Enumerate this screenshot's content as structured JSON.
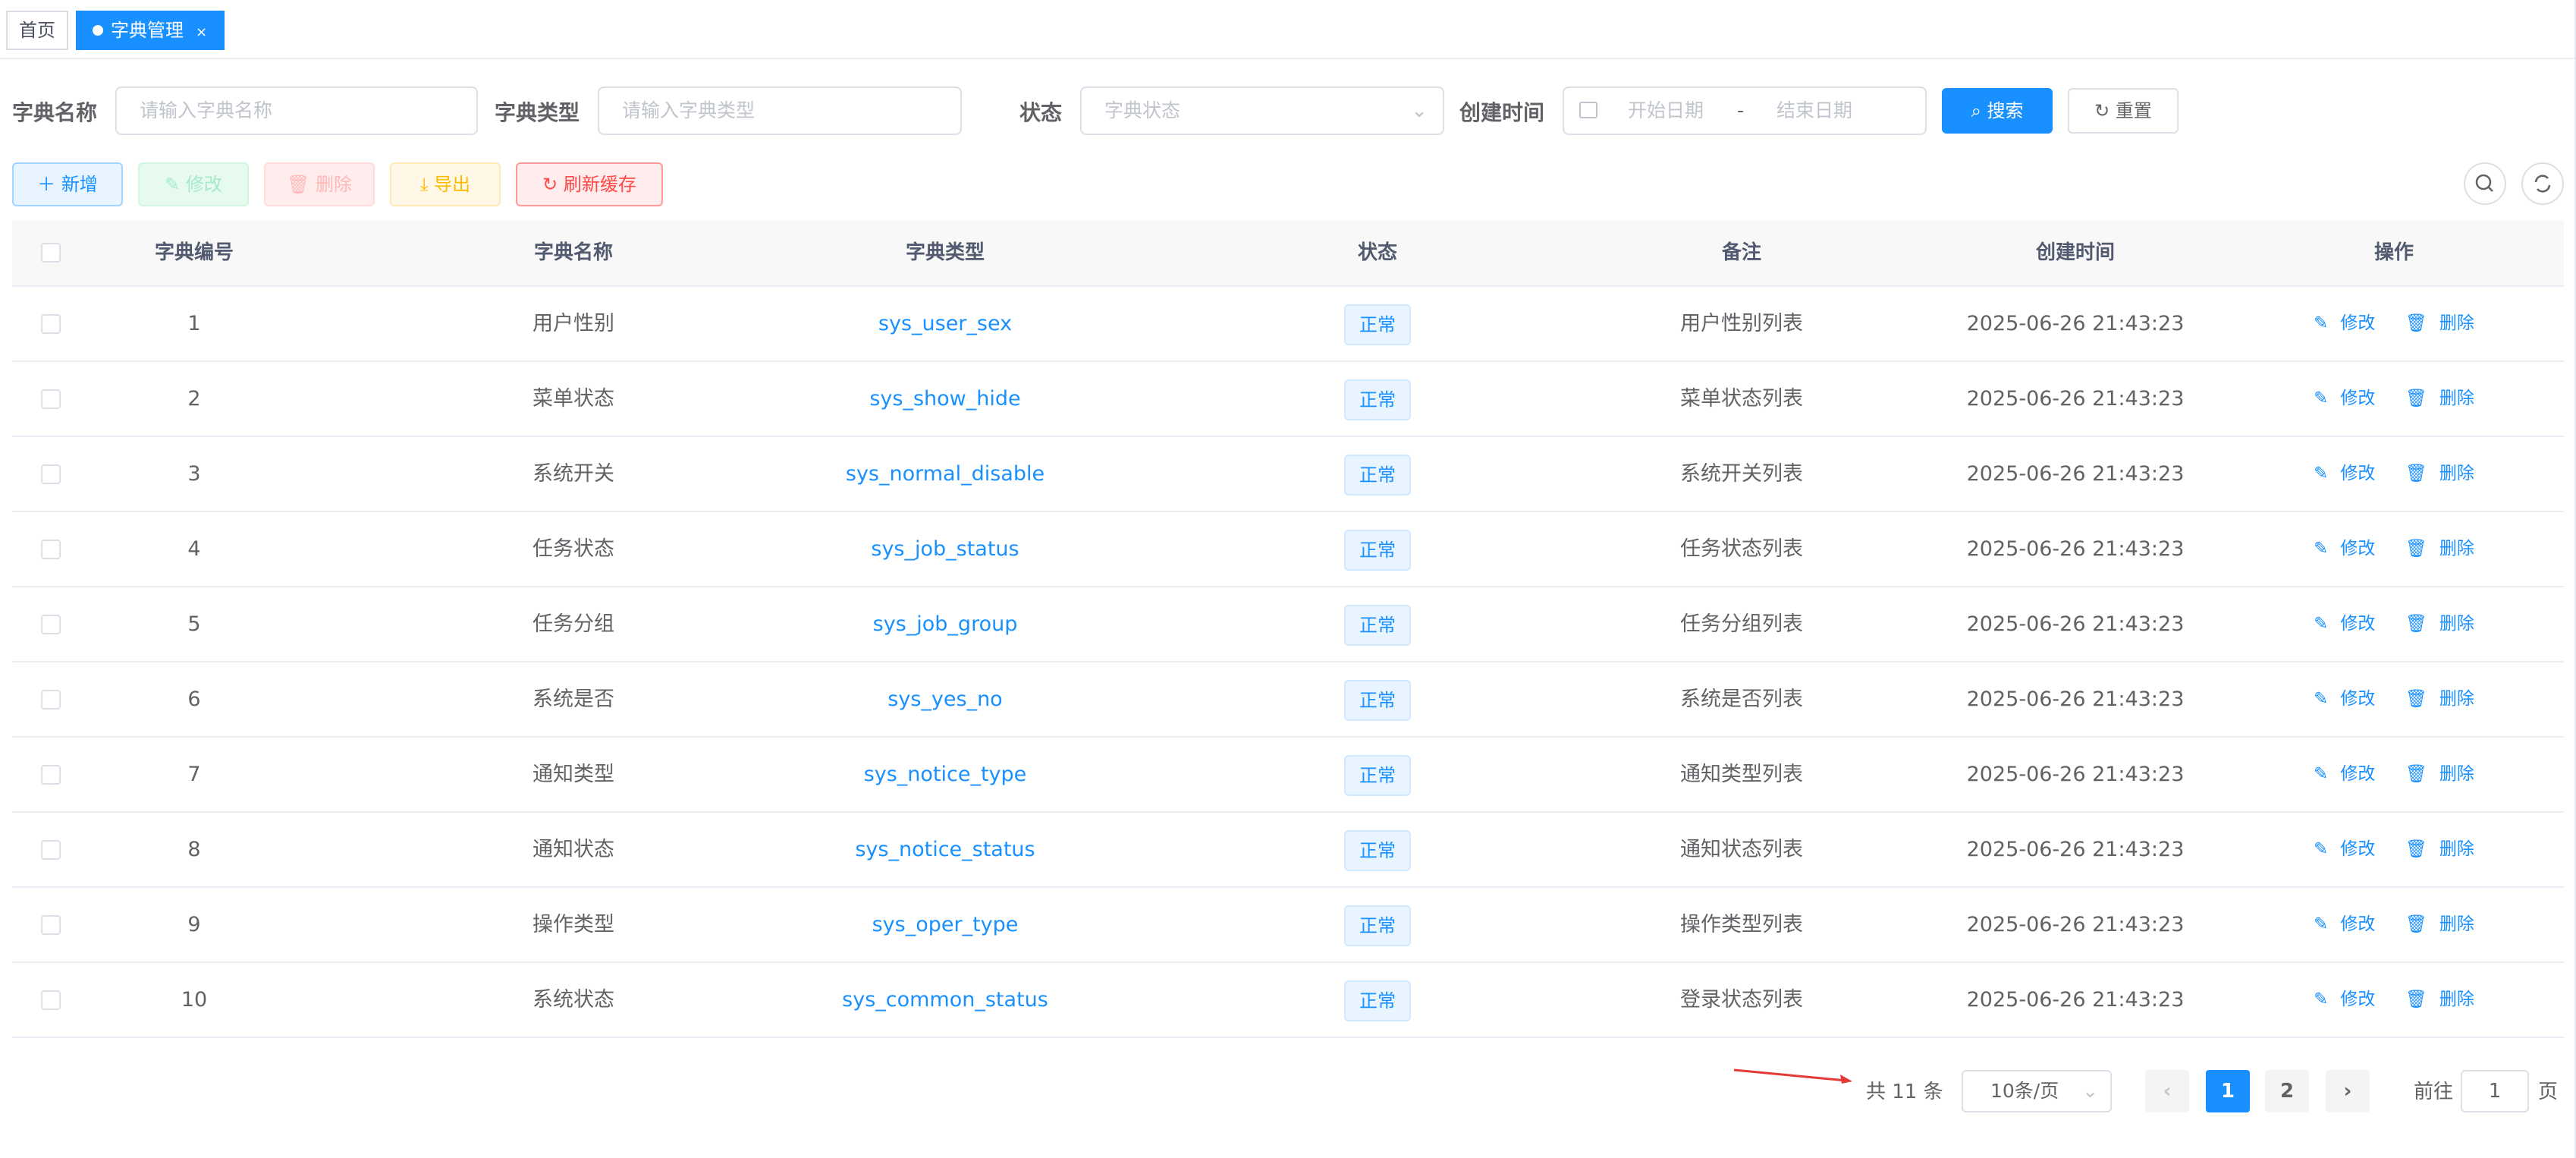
{
  "tabs": {
    "home": "首页",
    "active": "字典管理",
    "close": "×"
  },
  "search": {
    "name_label": "字典名称",
    "name_placeholder": "请输入字典名称",
    "type_label": "字典类型",
    "type_placeholder": "请输入字典类型",
    "status_label": "状态",
    "status_placeholder": "字典状态",
    "date_label": "创建时间",
    "start_placeholder": "开始日期",
    "date_sep": "-",
    "end_placeholder": "结束日期",
    "search_btn": "搜索",
    "reset_btn": "重置"
  },
  "toolbar": {
    "add": "新增",
    "edit": "修改",
    "delete": "删除",
    "export": "导出",
    "refresh": "刷新缓存"
  },
  "table": {
    "headers": [
      "字典编号",
      "字典名称",
      "字典类型",
      "状态",
      "备注",
      "创建时间",
      "操作"
    ],
    "rows": [
      {
        "id": "1",
        "name": "用户性别",
        "type": "sys_user_sex",
        "status": "正常",
        "remark": "用户性别列表",
        "time": "2025-06-26 21:43:23"
      },
      {
        "id": "2",
        "name": "菜单状态",
        "type": "sys_show_hide",
        "status": "正常",
        "remark": "菜单状态列表",
        "time": "2025-06-26 21:43:23"
      },
      {
        "id": "3",
        "name": "系统开关",
        "type": "sys_normal_disable",
        "status": "正常",
        "remark": "系统开关列表",
        "time": "2025-06-26 21:43:23"
      },
      {
        "id": "4",
        "name": "任务状态",
        "type": "sys_job_status",
        "status": "正常",
        "remark": "任务状态列表",
        "time": "2025-06-26 21:43:23"
      },
      {
        "id": "5",
        "name": "任务分组",
        "type": "sys_job_group",
        "status": "正常",
        "remark": "任务分组列表",
        "time": "2025-06-26 21:43:23"
      },
      {
        "id": "6",
        "name": "系统是否",
        "type": "sys_yes_no",
        "status": "正常",
        "remark": "系统是否列表",
        "time": "2025-06-26 21:43:23"
      },
      {
        "id": "7",
        "name": "通知类型",
        "type": "sys_notice_type",
        "status": "正常",
        "remark": "通知类型列表",
        "time": "2025-06-26 21:43:23"
      },
      {
        "id": "8",
        "name": "通知状态",
        "type": "sys_notice_status",
        "status": "正常",
        "remark": "通知状态列表",
        "time": "2025-06-26 21:43:23"
      },
      {
        "id": "9",
        "name": "操作类型",
        "type": "sys_oper_type",
        "status": "正常",
        "remark": "操作类型列表",
        "time": "2025-06-26 21:43:23"
      },
      {
        "id": "10",
        "name": "系统状态",
        "type": "sys_common_status",
        "status": "正常",
        "remark": "登录状态列表",
        "time": "2025-06-26 21:43:23"
      }
    ],
    "op_edit": "修改",
    "op_delete": "删除"
  },
  "pagination": {
    "total": "共 11 条",
    "page_size": "10条/页",
    "pages": [
      "1",
      "2"
    ],
    "current": "1",
    "goto_label": "前往",
    "goto_value": "1",
    "goto_unit": "页"
  },
  "colors": {
    "primary": "#1890ff",
    "danger": "#ff4949",
    "annotation_arrow": "#e53935"
  }
}
